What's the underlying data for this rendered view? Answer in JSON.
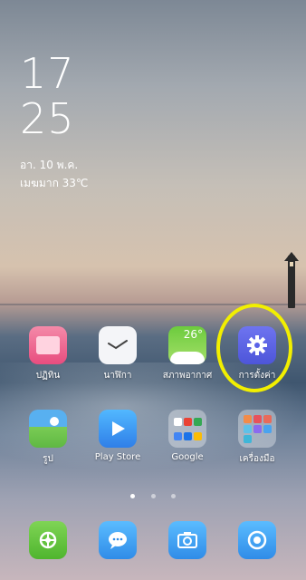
{
  "clock": {
    "hour": "17",
    "minute": "25"
  },
  "date": {
    "day_line": "อา. 10 พ.ค.",
    "weather_line": "เมฆมาก 33℃"
  },
  "home_row1": [
    {
      "label": "ปฏิทิน",
      "icon": "calendar-icon"
    },
    {
      "label": "นาฬิกา",
      "icon": "clock-icon"
    },
    {
      "label": "สภาพอากาศ",
      "icon": "weather-icon",
      "temp": "26°"
    },
    {
      "label": "การตั้งค่า",
      "icon": "settings-gear-icon"
    }
  ],
  "home_row2": [
    {
      "label": "รูป",
      "icon": "photos-icon"
    },
    {
      "label": "Play Store",
      "icon": "play-store-icon"
    },
    {
      "label": "Google",
      "icon": "google-folder-icon"
    },
    {
      "label": "เครื่องมือ",
      "icon": "tools-folder-icon"
    }
  ],
  "dock": [
    {
      "icon": "phone-icon"
    },
    {
      "icon": "messages-icon"
    },
    {
      "icon": "camera-icon"
    },
    {
      "icon": "browser-icon"
    }
  ],
  "colors": {
    "highlight": "#f2ef00",
    "settings": "#5b63e8",
    "calendar": "#ef5a87",
    "weather": "#8fd44a"
  }
}
